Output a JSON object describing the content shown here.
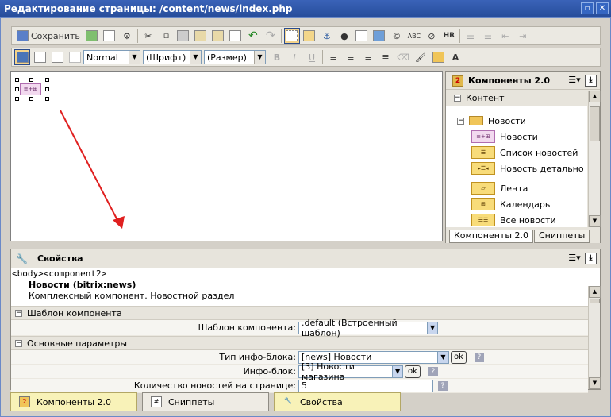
{
  "window": {
    "title": "Редактирование страницы: /content/news/index.php"
  },
  "toolbar1": {
    "save_label": "Сохранить"
  },
  "toolbar2": {
    "style_select": "Normal",
    "font_select": "(Шрифт)",
    "size_select": "(Размер)",
    "bold": "B",
    "italic": "I",
    "underline": "U"
  },
  "editor": {
    "component_chip": "≡+⊞"
  },
  "components_panel": {
    "title": "Компоненты 2.0",
    "section": "Контент",
    "folder": "Новости",
    "items": [
      {
        "label": "Новости",
        "icon": "news-icon"
      },
      {
        "label": "Список новостей",
        "icon": "list-icon"
      },
      {
        "label": "Новость детально",
        "icon": "detail-icon"
      },
      {
        "label": "Лента",
        "icon": "feed-icon"
      },
      {
        "label": "Календарь",
        "icon": "calendar-icon"
      },
      {
        "label": "Все новости",
        "icon": "all-news-icon"
      }
    ],
    "tabs": [
      "Компоненты 2.0",
      "Сниппеты"
    ]
  },
  "properties": {
    "title": "Свойства",
    "path": "<body><component2>",
    "component_title": "Новости (bitrix:news)",
    "component_desc": "Комплексный компонент. Новостной раздел",
    "section_template": "Шаблон компонента",
    "template_label": "Шаблон компонента:",
    "template_value": ".default (Встроенный шаблон)",
    "section_main": "Основные параметры",
    "iblock_type_label": "Тип инфо-блока:",
    "iblock_type_value": "[news] Новости",
    "iblock_label": "Инфо-блок:",
    "iblock_value": "[3] Новости магазина",
    "news_count_label": "Количество новостей на странице:",
    "news_count_value": "5",
    "ok": "ok",
    "help": "?"
  },
  "bottom_tabs": [
    "Компоненты 2.0",
    "Сниппеты",
    "Свойства"
  ]
}
